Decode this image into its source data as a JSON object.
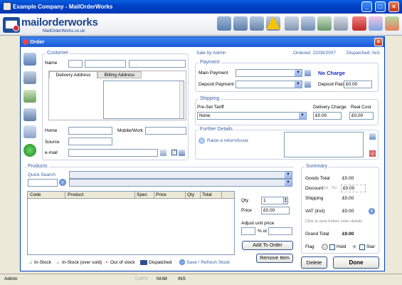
{
  "window": {
    "title": "Example Company - MailOrderWorks"
  },
  "logo": {
    "brand": "mailorderworks",
    "sub": "MailOrderWorks.co.uk"
  },
  "order": {
    "title": "Order",
    "sale_by": "Sale by Admin",
    "ordered": "Ordered: 22/08/2007",
    "dispatched": "Dispatched: N/A"
  },
  "customer": {
    "group_title": "Customer",
    "name_label": "Name",
    "tabs": [
      "Delivery Address",
      "Billing Address"
    ],
    "home_label": "Home",
    "mobile_label": "Mobile/Work",
    "source_label": "Source",
    "email_label": "e-mail"
  },
  "payment": {
    "group_title": "Payment",
    "main_label": "Main Payment",
    "no_charge": "No Charge",
    "deposit_label": "Deposit Payment",
    "deposit_paid_label": "Deposit Paid",
    "deposit_paid_value": "£0.00"
  },
  "shipping": {
    "group_title": "Shipping",
    "tariff_label": "Pre-Set Tariff",
    "tariff_value": "None",
    "delivery_label": "Delivery Charge",
    "delivery_value": "£0.00",
    "real_label": "Real Cost",
    "real_value": "£0.00"
  },
  "details": {
    "group_title": "Further Details",
    "return_link": "Raise a return/issue"
  },
  "products": {
    "group_title": "Products",
    "quick_search": "Quick Search",
    "columns": [
      "Code",
      "Product",
      "Spec",
      "Price",
      "Qty",
      "Total"
    ],
    "qty_label": "Qty",
    "qty_value": "1",
    "price_label": "Price",
    "price_value": "£0.00",
    "adjust_label": "Adjust unit price",
    "percent_or": "% or",
    "add_button": "Add To Order",
    "remove_button": "Remove Item"
  },
  "legend": {
    "in_stock": "In-Stock",
    "in_stock_over": "In-Stock (over sold)",
    "out_stock": "Out of stock",
    "dispatched": "Dispatched",
    "refresh": "Save / Refresh Stock"
  },
  "summary": {
    "group_title": "Summary",
    "goods_label": "Goods Total",
    "goods_value": "£0.00",
    "discount_label": "Discount",
    "discount_hint": "(or ..%)",
    "discount_value": "£0.00",
    "shipping_label": "Shipping",
    "shipping_value": "£0.00",
    "vat_label": "VAT (incl)",
    "vat_value": "£0.00",
    "hint": "Click to view further order details.",
    "grand_label": "Grand Total",
    "grand_value": "£0.00",
    "flag_label": "Flag",
    "hold_label": "Hold",
    "star_label": "Star",
    "delete_button": "Delete",
    "done_button": "Done"
  },
  "statusbar": {
    "user": "Admin",
    "caps": "CAPS",
    "num": "NUM",
    "ins": "INS"
  },
  "colors": {
    "titlebar": "#0a5ee0",
    "accent": "#3a5fa8",
    "no_charge": "#1a2fc8"
  }
}
